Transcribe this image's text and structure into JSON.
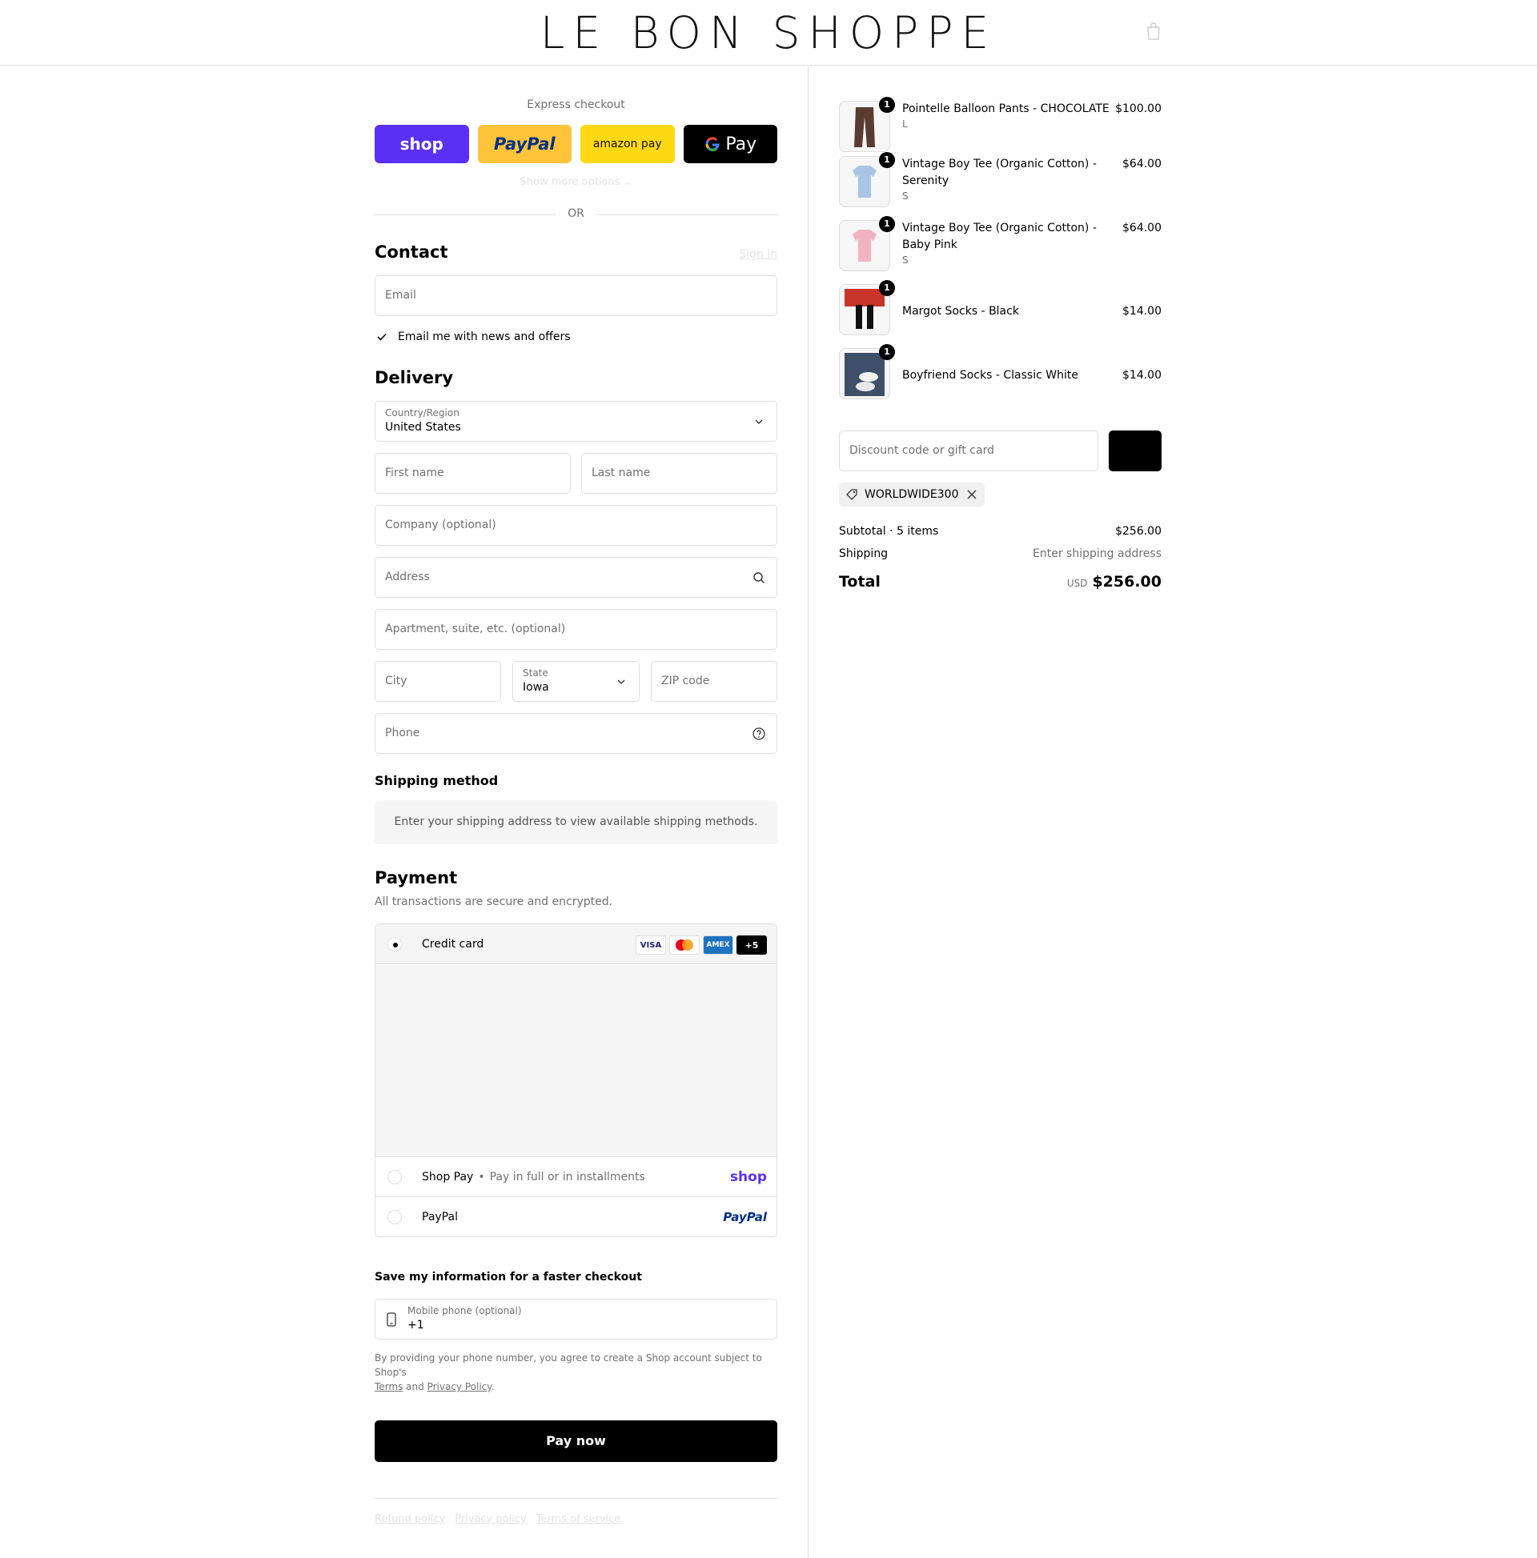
{
  "header": {
    "logo": "LE BON SHOPPE",
    "cart_icon": "shopping-bag-icon"
  },
  "express": {
    "title": "Express checkout",
    "buttons": {
      "shop": "shop",
      "paypal": "PayPal",
      "amazon": "amazon pay",
      "gpay": "Pay"
    },
    "more_options": "Show more options",
    "or": "OR"
  },
  "contact": {
    "heading": "Contact",
    "sign_in": "Sign in",
    "email_placeholder": "Email",
    "newsletter_label": "Email me with news and offers",
    "newsletter_checked": true
  },
  "delivery": {
    "heading": "Delivery",
    "country_label": "Country/Region",
    "country_value": "United States",
    "first_name_placeholder": "First name",
    "last_name_placeholder": "Last name",
    "company_placeholder": "Company (optional)",
    "address_placeholder": "Address",
    "apartment_placeholder": "Apartment, suite, etc. (optional)",
    "city_placeholder": "City",
    "state_label": "State",
    "state_value": "Iowa",
    "zip_placeholder": "ZIP code",
    "phone_placeholder": "Phone"
  },
  "shipping": {
    "heading": "Shipping method",
    "message": "Enter your shipping address to view available shipping methods."
  },
  "payment": {
    "heading": "Payment",
    "subtitle": "All transactions are secure and encrypted.",
    "credit_card_label": "Credit card",
    "card_logos": {
      "visa": "VISA",
      "amex": "AMEX",
      "more": "+5"
    },
    "shop_pay_label": "Shop Pay",
    "shop_pay_sub": "Pay in full or in installments",
    "shop_pay_brand": "shop",
    "paypal_label": "PayPal",
    "paypal_brand": "PayPal"
  },
  "save_info": {
    "heading": "Save my information for a faster checkout",
    "mobile_label": "Mobile phone (optional)",
    "mobile_value": "+1",
    "legal_prefix": "By providing your phone number, you agree to create a Shop account subject to Shop's",
    "terms": "Terms",
    "and": "and",
    "privacy": "Privacy Policy",
    "period": "."
  },
  "pay_now": "Pay now",
  "footer_links": [
    "Refund policy",
    "Privacy policy",
    "Terms of service"
  ],
  "summary": {
    "items": [
      {
        "name": "Pointelle Balloon Pants - CHOCOLATE",
        "variant": "L",
        "price": "$100.00",
        "qty": "1",
        "color": "#5a3b32"
      },
      {
        "name": "Vintage Boy Tee (Organic Cotton) - Serenity",
        "variant": "S",
        "price": "$64.00",
        "qty": "1",
        "color": "#a9c4e4"
      },
      {
        "name": "Vintage Boy Tee (Organic Cotton) - Baby Pink",
        "variant": "S",
        "price": "$64.00",
        "qty": "1",
        "color": "#f2b3c0"
      },
      {
        "name": "Margot Socks - Black",
        "variant": "",
        "price": "$14.00",
        "qty": "1",
        "color": "#c8342a"
      },
      {
        "name": "Boyfriend Socks - Classic White",
        "variant": "",
        "price": "$14.00",
        "qty": "1",
        "color": "#3d4f6b"
      }
    ],
    "discount_placeholder": "Discount code or gift card",
    "applied_code": "WORLDWIDE300",
    "subtotal_label": "Subtotal · 5 items",
    "subtotal_value": "$256.00",
    "shipping_label": "Shipping",
    "shipping_value": "Enter shipping address",
    "total_label": "Total",
    "currency": "USD",
    "total_value": "$256.00"
  }
}
